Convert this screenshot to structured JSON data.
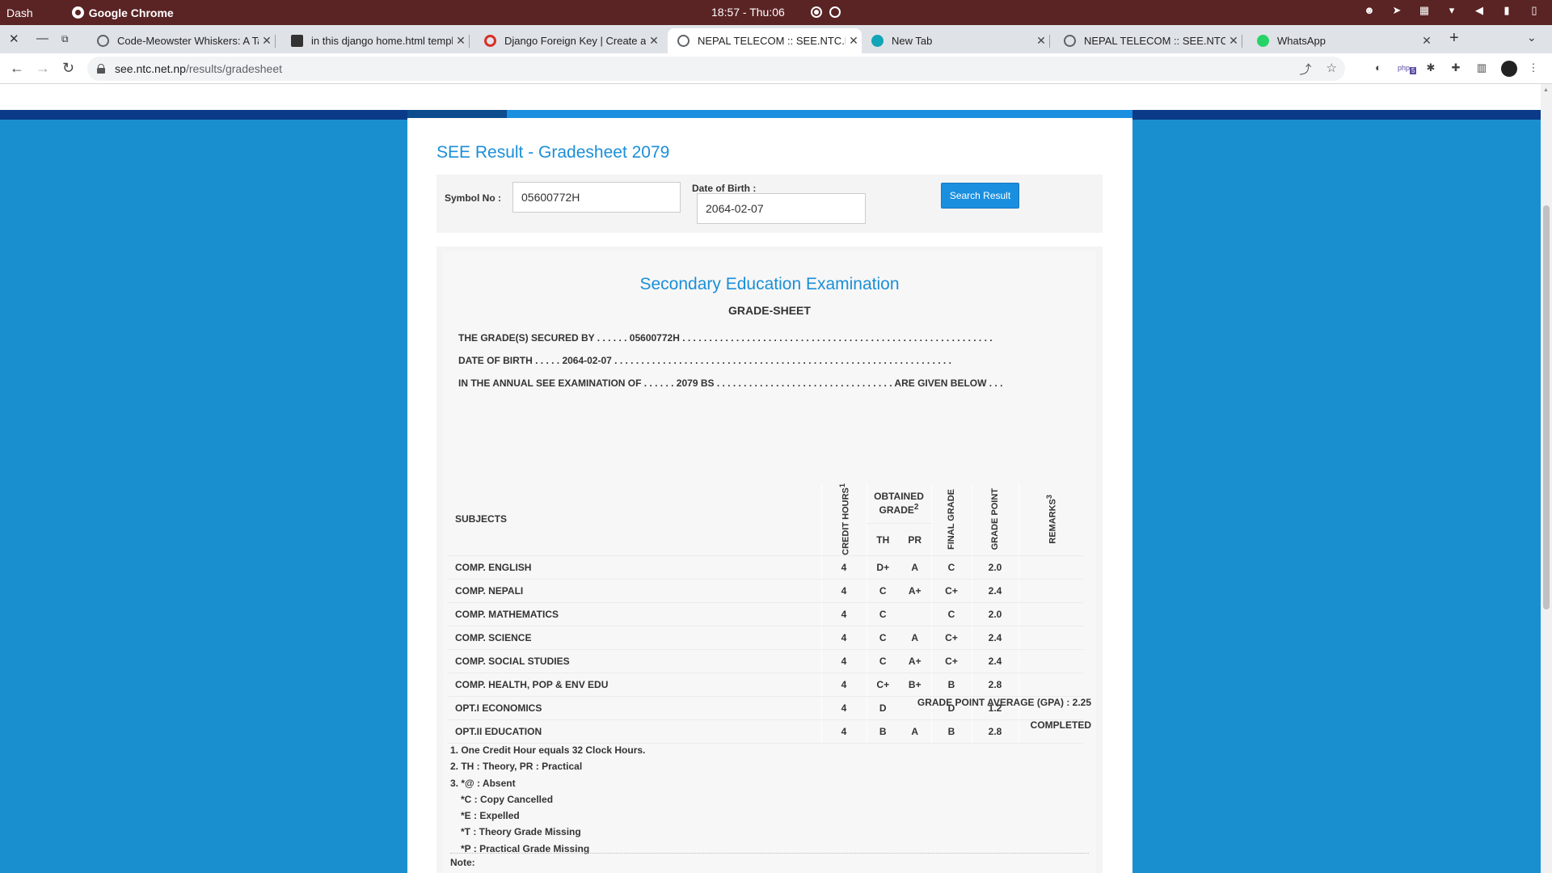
{
  "os": {
    "dash_label": "Dash",
    "app_name": "Google Chrome",
    "clock": "18:57 - Thu:06"
  },
  "tabs": [
    {
      "title": "Code-Meowster Whiskers: A Ta",
      "icon": "globe-icon",
      "color": "#5f6368"
    },
    {
      "title": "in this django home.html templ",
      "icon": "grid-icon",
      "color": "#333333"
    },
    {
      "title": "Django Foreign Key | Create a D",
      "icon": "spiral-icon",
      "color": "#d93025"
    },
    {
      "title": "NEPAL TELECOM :: SEE.NTC.N",
      "icon": "globe-icon",
      "color": "#5f6368"
    },
    {
      "title": "New Tab",
      "icon": "m-icon",
      "color": "#12a4b7"
    },
    {
      "title": "NEPAL TELECOM :: SEE.NTC.N",
      "icon": "globe-icon",
      "color": "#5f6368"
    },
    {
      "title": "WhatsApp",
      "icon": "whatsapp-icon",
      "color": "#25d366"
    }
  ],
  "address": {
    "host": "see.ntc.net.np",
    "path": "/results/gradesheet"
  },
  "extensions": {
    "php_badge": "5"
  },
  "page": {
    "title": "SEE Result - Gradesheet 2079",
    "search": {
      "symbol_label": "Symbol No :",
      "symbol_value": "05600772H",
      "dob_label": "Date of Birth :",
      "dob_value": "2064-02-07",
      "button_label": "Search Result"
    },
    "sheet": {
      "exam_title": "Secondary Education Examination",
      "heading": "GRADE-SHEET",
      "line1": "THE GRADE(S) SECURED BY . . . . . . 05600772H . . . . . . . . . . . . . . . . . . . . . . . . . . . . . . . . . . . . . . . . . . . . . . . . . . . . . . . . . .",
      "line2": "DATE OF BIRTH . . . . . 2064-02-07 . . . . . . . . . . . . . . . . . . . . . . . . . . . . . . . . . . . . . . . . . . . . . . . . . . . . . . . . . . . . . . .",
      "line3": "IN THE ANNUAL SEE EXAMINATION OF . . . . . . 2079 BS . . . . . . . . . . . . . . . . . . . . . . . . . . . . . . . . . ARE GIVEN BELOW . . .",
      "headers": {
        "subjects": "SUBJECTS",
        "credit": "CREDIT HOURS",
        "credit_sup": "1",
        "obtained": "OBTAINED GRADE",
        "obtained_sup": "2",
        "th": "TH",
        "pr": "PR",
        "final": "FINAL GRADE",
        "point": "GRADE POINT",
        "remarks": "REMARKS",
        "remarks_sup": "3"
      },
      "rows": [
        {
          "subject": "COMP. ENGLISH",
          "credit": "4",
          "th": "D+",
          "pr": "A",
          "final": "C",
          "point": "2.0",
          "remarks": ""
        },
        {
          "subject": "COMP. NEPALI",
          "credit": "4",
          "th": "C",
          "pr": "A+",
          "final": "C+",
          "point": "2.4",
          "remarks": ""
        },
        {
          "subject": "COMP. MATHEMATICS",
          "credit": "4",
          "th": "C",
          "pr": "",
          "final": "C",
          "point": "2.0",
          "remarks": ""
        },
        {
          "subject": "COMP. SCIENCE",
          "credit": "4",
          "th": "C",
          "pr": "A",
          "final": "C+",
          "point": "2.4",
          "remarks": ""
        },
        {
          "subject": "COMP. SOCIAL STUDIES",
          "credit": "4",
          "th": "C",
          "pr": "A+",
          "final": "C+",
          "point": "2.4",
          "remarks": ""
        },
        {
          "subject": "COMP. HEALTH, POP & ENV EDU",
          "credit": "4",
          "th": "C+",
          "pr": "B+",
          "final": "B",
          "point": "2.8",
          "remarks": ""
        },
        {
          "subject": "OPT.I ECONOMICS",
          "credit": "4",
          "th": "D",
          "pr": "",
          "final": "D",
          "point": "1.2",
          "remarks": ""
        },
        {
          "subject": "OPT.II EDUCATION",
          "credit": "4",
          "th": "B",
          "pr": "A",
          "final": "B",
          "point": "2.8",
          "remarks": ""
        }
      ],
      "gpa": "GRADE POINT AVERAGE (GPA) : 2.25",
      "status": "COMPLETED",
      "notes": [
        "1. One Credit Hour equals 32 Clock Hours.",
        "2. TH : Theory, PR : Practical",
        "3. *@ : Absent",
        "*C : Copy Cancelled",
        "*E : Expelled",
        "*T : Theory Grade Missing",
        "*P : Practical Grade Missing"
      ],
      "note_label": "Note:"
    }
  },
  "colors": {
    "page_bg": "#1a8fd0",
    "title_blue": "#1a8fd8",
    "button_blue": "#1a8fe0",
    "os_bar": "#5a2324"
  }
}
